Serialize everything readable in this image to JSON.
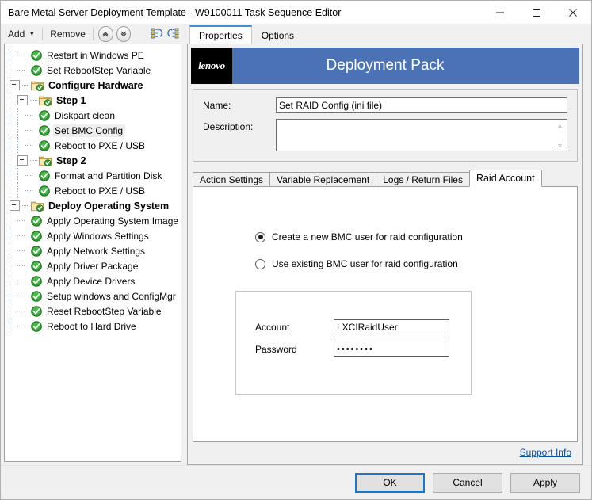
{
  "window": {
    "title": "Bare Metal Server Deployment Template - W9100011 Task Sequence Editor",
    "minimize_label": "Minimize",
    "maximize_label": "Maximize",
    "close_label": "Close"
  },
  "toolbar": {
    "add_label": "Add",
    "remove_label": "Remove",
    "move_up_label": "Move Up",
    "move_down_label": "Move Down",
    "icon_a_label": "undo-sequence-icon",
    "icon_b_label": "redo-sequence-icon"
  },
  "tree": {
    "items": [
      {
        "label": "Restart in Windows PE",
        "depth": 1,
        "icon": "check-icon",
        "bold": false,
        "selected": false,
        "expander": false
      },
      {
        "label": "Set RebootStep Variable",
        "depth": 1,
        "icon": "check-icon",
        "bold": false,
        "selected": false,
        "expander": false
      },
      {
        "label": "Configure Hardware",
        "depth": 0,
        "icon": "folder-check-icon",
        "bold": true,
        "selected": false,
        "expander": true
      },
      {
        "label": "Step 1",
        "depth": 1,
        "icon": "folder-check-icon",
        "bold": true,
        "selected": false,
        "expander": true
      },
      {
        "label": "Diskpart clean",
        "depth": 2,
        "icon": "check-icon",
        "bold": false,
        "selected": false,
        "expander": false
      },
      {
        "label": "Set BMC Config",
        "depth": 2,
        "icon": "check-icon",
        "bold": false,
        "selected": true,
        "expander": false
      },
      {
        "label": "Reboot to PXE / USB",
        "depth": 2,
        "icon": "check-icon",
        "bold": false,
        "selected": false,
        "expander": false
      },
      {
        "label": "Step 2",
        "depth": 1,
        "icon": "folder-check-icon",
        "bold": true,
        "selected": false,
        "expander": true
      },
      {
        "label": "Format and Partition Disk",
        "depth": 2,
        "icon": "check-icon",
        "bold": false,
        "selected": false,
        "expander": false
      },
      {
        "label": "Reboot to PXE / USB",
        "depth": 2,
        "icon": "check-icon",
        "bold": false,
        "selected": false,
        "expander": false
      },
      {
        "label": "Deploy Operating System",
        "depth": 0,
        "icon": "folder-check-icon",
        "bold": true,
        "selected": false,
        "expander": true
      },
      {
        "label": "Apply Operating System Image",
        "depth": 1,
        "icon": "check-icon",
        "bold": false,
        "selected": false,
        "expander": false
      },
      {
        "label": "Apply Windows Settings",
        "depth": 1,
        "icon": "check-icon",
        "bold": false,
        "selected": false,
        "expander": false
      },
      {
        "label": "Apply Network Settings",
        "depth": 1,
        "icon": "check-icon",
        "bold": false,
        "selected": false,
        "expander": false
      },
      {
        "label": "Apply Driver Package",
        "depth": 1,
        "icon": "check-icon",
        "bold": false,
        "selected": false,
        "expander": false
      },
      {
        "label": "Apply Device Drivers",
        "depth": 1,
        "icon": "check-icon",
        "bold": false,
        "selected": false,
        "expander": false
      },
      {
        "label": "Setup windows and ConfigMgr",
        "depth": 1,
        "icon": "check-icon",
        "bold": false,
        "selected": false,
        "expander": false
      },
      {
        "label": "Reset RebootStep Variable",
        "depth": 1,
        "icon": "check-icon",
        "bold": false,
        "selected": false,
        "expander": false
      },
      {
        "label": "Reboot to Hard Drive",
        "depth": 1,
        "icon": "check-icon",
        "bold": false,
        "selected": false,
        "expander": false
      }
    ]
  },
  "top_tabs": [
    {
      "label": "Properties",
      "active": true
    },
    {
      "label": "Options",
      "active": false
    }
  ],
  "banner": {
    "logo_text": "lenovo",
    "title": "Deployment Pack",
    "bg_color": "#4a72b5",
    "logo_bg_color": "#000000"
  },
  "fields": {
    "name_label": "Name:",
    "name_value": "Set RAID Config (ini file)",
    "name_placeholder": "",
    "description_label": "Description:",
    "description_value": "",
    "description_placeholder": "",
    "spin_up": "⌃",
    "spin_down": "⌄"
  },
  "property_tabs": [
    {
      "label": "Action Settings",
      "active": false
    },
    {
      "label": "Variable Replacement",
      "active": false
    },
    {
      "label": "Logs / Return Files",
      "active": false
    },
    {
      "label": "Raid Account",
      "active": true
    }
  ],
  "raid_account": {
    "options": [
      {
        "label": "Create a new BMC user for raid configuration",
        "selected": true
      },
      {
        "label": "Use existing BMC user for raid configuration",
        "selected": false
      }
    ],
    "account_label": "Account",
    "account_value": "LXCIRaidUser",
    "password_label": "Password",
    "password_value": "••••••••"
  },
  "support": {
    "link_label": "Support Info",
    "link_color": "#0b51a6"
  },
  "footer": {
    "ok_label": "OK",
    "cancel_label": "Cancel",
    "apply_label": "Apply",
    "primary_color": "#1878c8"
  }
}
